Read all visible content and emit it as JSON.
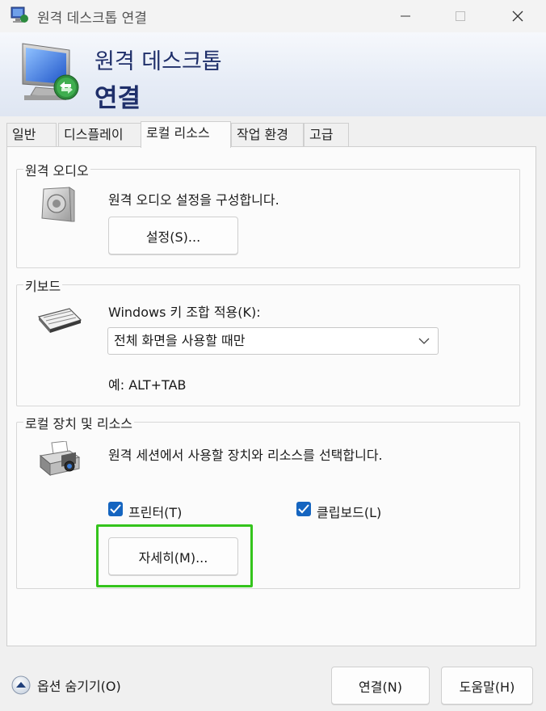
{
  "window": {
    "title": "원격 데스크톱 연결"
  },
  "banner": {
    "line1": "원격 데스크톱",
    "line2": "연결"
  },
  "tabs": [
    {
      "label": "일반",
      "active": false
    },
    {
      "label": "디스플레이",
      "active": false
    },
    {
      "label": "로컬 리소스",
      "active": true
    },
    {
      "label": "작업 환경",
      "active": false
    },
    {
      "label": "고급",
      "active": false
    }
  ],
  "audio": {
    "group_title": "원격 오디오",
    "description": "원격 오디오 설정을 구성합니다.",
    "settings_button": "설정(S)..."
  },
  "keyboard": {
    "group_title": "키보드",
    "label": "Windows 키 조합 적용(K):",
    "selected": "전체 화면을 사용할 때만",
    "example": "예: ALT+TAB"
  },
  "devices": {
    "group_title": "로컬 장치 및 리소스",
    "description": "원격 세션에서 사용할 장치와 리소스를 선택합니다.",
    "printer_label": "프린터(T)",
    "printer_checked": true,
    "clipboard_label": "클립보드(L)",
    "clipboard_checked": true,
    "more_button": "자세히(M)..."
  },
  "footer": {
    "hide_options": "옵션 숨기기(O)",
    "connect_button": "연결(N)",
    "help_button": "도움말(H)"
  },
  "colors": {
    "accent": "#1565c0",
    "banner_text": "#1f2f6a",
    "highlight": "#34c41c"
  }
}
